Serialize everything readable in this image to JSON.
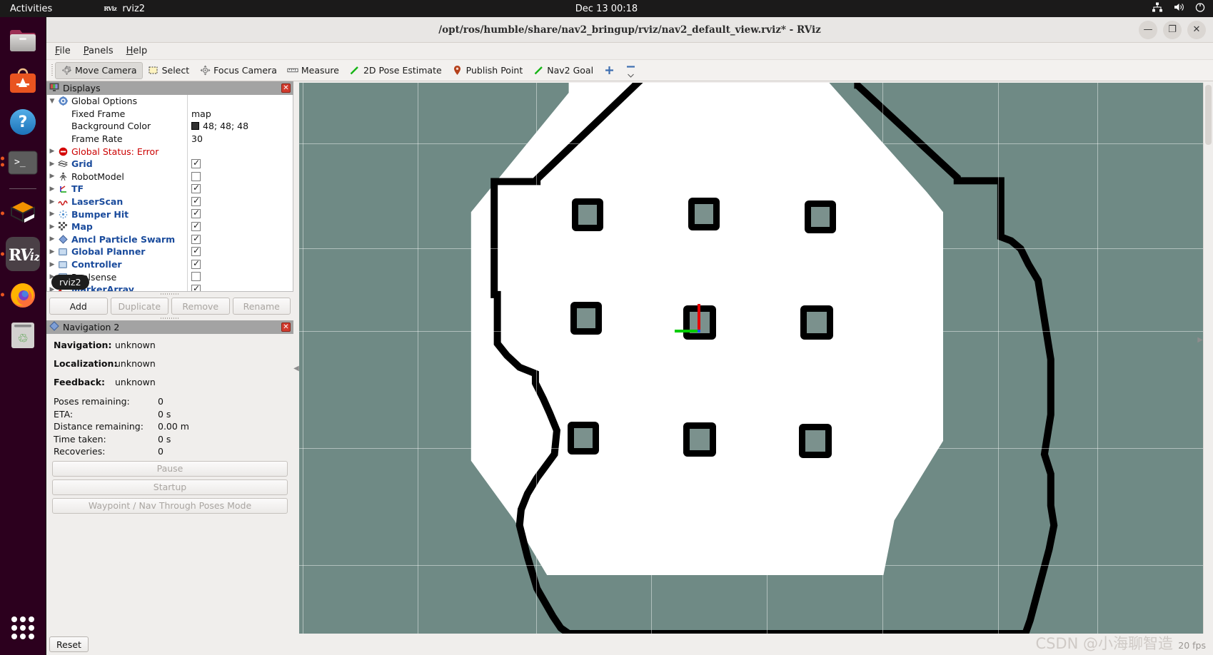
{
  "desktop": {
    "activities_label": "Activities",
    "app_indicator": "rviz2",
    "app_indicator_icon": "rviz-mini-icon",
    "clock": "Dec 13 00:18",
    "tray_icons": [
      "network-icon",
      "volume-icon",
      "power-icon"
    ],
    "dock_items": [
      {
        "name": "files-icon",
        "label": "Files",
        "running": false
      },
      {
        "name": "app-store-icon",
        "label": "Ubuntu Software",
        "running": false
      },
      {
        "name": "help-icon",
        "label": "Help",
        "running": false
      },
      {
        "name": "terminal-icon",
        "label": "Terminal",
        "running": true
      },
      {
        "name": "gazebo-icon",
        "label": "Gazebo",
        "running": true
      },
      {
        "name": "rviz-icon",
        "label": "RViz",
        "running": true
      },
      {
        "name": "firefox-icon",
        "label": "Firefox",
        "running": true
      },
      {
        "name": "trash-icon",
        "label": "Trash",
        "running": false
      },
      {
        "name": "show-apps-icon",
        "label": "Show Applications",
        "running": false
      }
    ]
  },
  "window": {
    "title": "/opt/ros/humble/share/nav2_bringup/rviz/nav2_default_view.rviz* - RViz",
    "minimize_label": "—",
    "maximize_label": "❐",
    "close_label": "✕"
  },
  "menubar": {
    "items": [
      {
        "label": "File",
        "mnemonic": "F"
      },
      {
        "label": "Panels",
        "mnemonic": "P"
      },
      {
        "label": "Help",
        "mnemonic": "H"
      }
    ]
  },
  "toolbar": {
    "tools": [
      {
        "label": "Move Camera",
        "icon": "move-camera-icon",
        "active": true
      },
      {
        "label": "Select",
        "icon": "select-icon",
        "active": false
      },
      {
        "label": "Focus Camera",
        "icon": "focus-camera-icon",
        "active": false
      },
      {
        "label": "Measure",
        "icon": "measure-icon",
        "active": false
      },
      {
        "label": "2D Pose Estimate",
        "icon": "pose-estimate-icon",
        "active": false
      },
      {
        "label": "Publish Point",
        "icon": "publish-point-icon",
        "active": false
      },
      {
        "label": "Nav2 Goal",
        "icon": "nav2-goal-icon",
        "active": false
      }
    ],
    "add_tool_icon": "plus-icon",
    "remove_tool_icon": "minus-icon"
  },
  "displays_panel": {
    "title": "Displays",
    "title_icon": "displays-icon",
    "close_label": "✕",
    "rows": [
      {
        "label": "Global Options",
        "kind": "group",
        "icon": "gear-icon",
        "twisty": "down",
        "indent": 0,
        "value": null,
        "check": null
      },
      {
        "label": "Fixed Frame",
        "kind": "prop",
        "icon": null,
        "twisty": null,
        "indent": 1,
        "value": "map",
        "check": null
      },
      {
        "label": "Background Color",
        "kind": "prop",
        "icon": null,
        "twisty": null,
        "indent": 1,
        "value": "48; 48; 48",
        "swatch": "#303030",
        "check": null
      },
      {
        "label": "Frame Rate",
        "kind": "prop",
        "icon": null,
        "twisty": null,
        "indent": 1,
        "value": "30",
        "check": null
      },
      {
        "label": "Global Status: Error",
        "kind": "error",
        "icon": "error-icon",
        "twisty": "right",
        "indent": 0,
        "value": null,
        "check": null
      },
      {
        "label": "Grid",
        "kind": "display",
        "icon": "grid-icon",
        "twisty": "right",
        "indent": 0,
        "value": null,
        "check": true
      },
      {
        "label": "RobotModel",
        "kind": "display-off",
        "icon": "robotmodel-icon",
        "twisty": "right",
        "indent": 0,
        "value": null,
        "check": false
      },
      {
        "label": "TF",
        "kind": "display",
        "icon": "tf-icon",
        "twisty": "right",
        "indent": 0,
        "value": null,
        "check": true
      },
      {
        "label": "LaserScan",
        "kind": "display",
        "icon": "laserscan-icon",
        "twisty": "right",
        "indent": 0,
        "value": null,
        "check": true
      },
      {
        "label": "Bumper Hit",
        "kind": "display",
        "icon": "bumperhit-icon",
        "twisty": "right",
        "indent": 0,
        "value": null,
        "check": true
      },
      {
        "label": "Map",
        "kind": "display",
        "icon": "map-icon",
        "twisty": "right",
        "indent": 0,
        "value": null,
        "check": true
      },
      {
        "label": "Amcl Particle Swarm",
        "kind": "display",
        "icon": "posearray-icon",
        "twisty": "right",
        "indent": 0,
        "value": null,
        "check": true
      },
      {
        "label": "Global Planner",
        "kind": "display",
        "icon": "group-icon",
        "twisty": "right",
        "indent": 0,
        "value": null,
        "check": true
      },
      {
        "label": "Controller",
        "kind": "display",
        "icon": "group-icon",
        "twisty": "right",
        "indent": 0,
        "value": null,
        "check": true
      },
      {
        "label": "Realsense",
        "kind": "display-off",
        "icon": "group-icon",
        "twisty": "right",
        "indent": 0,
        "value": null,
        "check": false
      },
      {
        "label": "MarkerArray",
        "kind": "display",
        "icon": "markerarray-icon",
        "twisty": "right",
        "indent": 0,
        "value": null,
        "check": true
      }
    ],
    "tooltip": "rviz2",
    "buttons": [
      {
        "label": "Add",
        "enabled": true
      },
      {
        "label": "Duplicate",
        "enabled": false
      },
      {
        "label": "Remove",
        "enabled": false
      },
      {
        "label": "Rename",
        "enabled": false
      }
    ]
  },
  "navigation_panel": {
    "title": "Navigation 2",
    "title_icon": "nav2-icon",
    "close_label": "✕",
    "status": [
      {
        "key": "Navigation:",
        "value": "unknown"
      },
      {
        "key": "Localization:",
        "value": "unknown"
      },
      {
        "key": "Feedback:",
        "value": "unknown"
      }
    ],
    "metrics": [
      {
        "key": "Poses remaining:",
        "value": "0"
      },
      {
        "key": "ETA:",
        "value": "0 s"
      },
      {
        "key": "Distance remaining:",
        "value": "0.00 m"
      },
      {
        "key": "Time taken:",
        "value": "0 s"
      },
      {
        "key": "Recoveries:",
        "value": "0"
      }
    ],
    "buttons": [
      {
        "label": "Pause",
        "enabled": false
      },
      {
        "label": "Startup",
        "enabled": false
      },
      {
        "label": "Waypoint / Nav Through Poses Mode",
        "enabled": false
      }
    ]
  },
  "bottom_bar": {
    "reset_label": "Reset"
  },
  "render_view": {
    "background_color": "#6f8a85",
    "free_space_color": "#ffffff",
    "wall_color": "#000000",
    "obstacle_fill_color": "#7b918d",
    "grid_line_color": "rgba(255,255,255,0.45)",
    "axes": {
      "x_color": "#00cc00",
      "y_color": "#e60000",
      "origin_color": "#1a53ff"
    },
    "fps_label": "20 fps",
    "watermark": "CSDN @小海聊智造"
  }
}
